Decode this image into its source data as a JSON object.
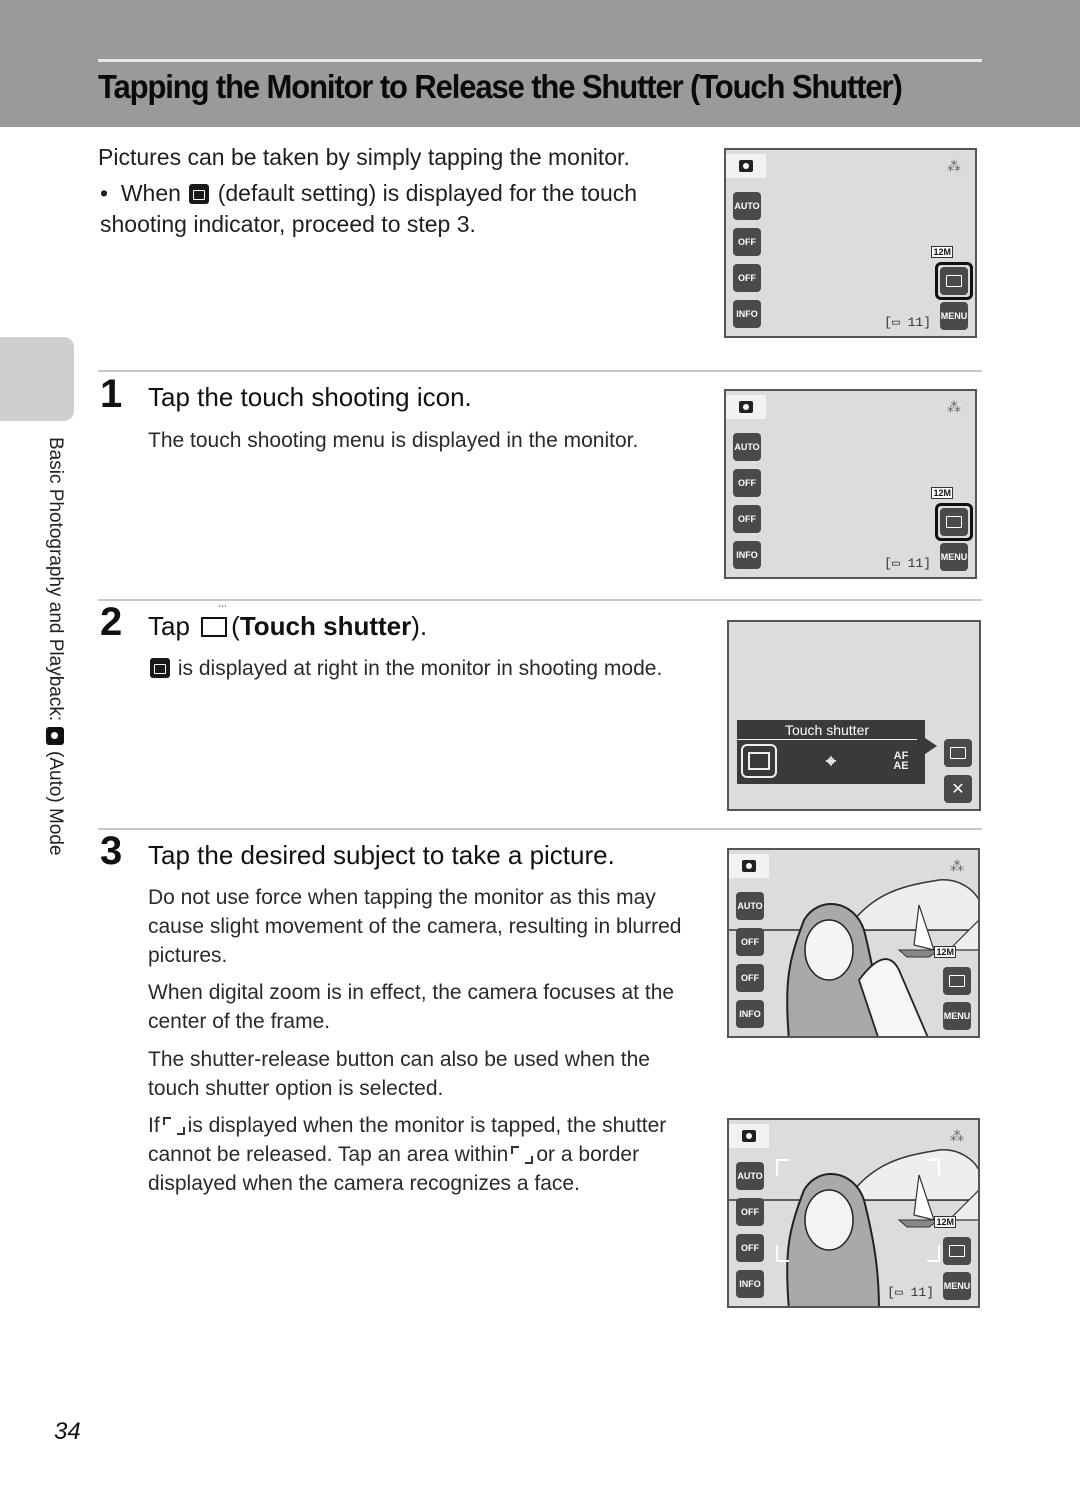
{
  "header": {
    "title": "Tapping the Monitor to Release the Shutter (Touch Shutter)",
    "background_color": "#9a9a9a"
  },
  "side_tab": {
    "text_before_icon": "Basic Photography and Playback:",
    "icon": "camera-auto-icon",
    "text_after_icon": "(Auto) Mode"
  },
  "intro": {
    "text": "Pictures can be taken by simply tapping the monitor.",
    "bullet": {
      "before_icon": "When",
      "icon": "touch-shooting-icon",
      "after_icon": "(default setting) is displayed for the touch shooting indicator, proceed to step 3."
    }
  },
  "steps": [
    {
      "number": "1",
      "title": "Tap the touch shooting icon.",
      "paragraphs": [
        "The touch shooting menu is displayed in the monitor."
      ]
    },
    {
      "number": "2",
      "title_before_icon": "Tap",
      "title_icon": "touch-shutter-icon",
      "title_open": "(",
      "title_bold": "Touch shutter",
      "title_close": ").",
      "paragraph_icon": "touch-shooting-icon",
      "paragraph_after_icon": "is displayed at right in the monitor in shooting mode."
    },
    {
      "number": "3",
      "title": "Tap the desired subject to take a picture.",
      "paragraphs": [
        "Do not use force when tapping the monitor as this may cause slight movement of the camera, resulting in blurred pictures.",
        "When digital zoom is in effect, the camera focuses at the center of the frame.",
        "The shutter-release button can also be used when the touch shutter option is selected."
      ],
      "focus_note": {
        "part1": "If",
        "part2": "is displayed when the monitor is tapped, the shutter cannot be released. Tap an area within",
        "part3": "or a border displayed when the camera recognizes a face."
      }
    }
  ],
  "monitor": {
    "left_buttons": [
      "AUTO",
      "OFF",
      "OFF",
      "INFO"
    ],
    "left_button_icons": [
      "flash-auto-icon",
      "self-timer-off-icon",
      "macro-off-icon",
      "info-icon"
    ],
    "menu_label": "MENU",
    "image_size": "12M",
    "shots_remaining": "[▭ 11]",
    "vr_icon": "vibration-reduction-icon"
  },
  "touch_menu": {
    "title": "Touch shutter",
    "options": [
      "touch-shutter",
      "subject-tracking",
      "AF/AE"
    ],
    "option_labels": [
      "",
      "⌖",
      "AF\nAE"
    ],
    "close_label": "✕"
  },
  "page_number": "34"
}
